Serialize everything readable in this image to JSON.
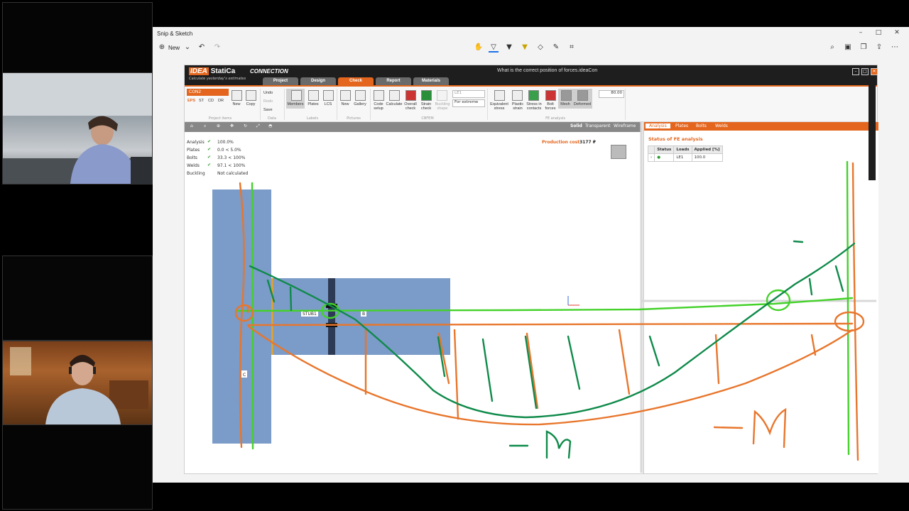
{
  "snip": {
    "title": "Snip & Sketch",
    "new_label": "New",
    "minimize": "–",
    "maximize": "□",
    "close": "✕"
  },
  "app": {
    "brand": "IDEA",
    "brand2": "StatiCa",
    "tagline": "Calculate yesterday's estimates",
    "product": "CONNECTION",
    "doc_title": "What is the correct position of forces.ideaCon",
    "tabs": [
      "Project",
      "Design",
      "Check",
      "Report",
      "Materials"
    ],
    "active_tab": "Check"
  },
  "ribbon": {
    "con_select": "CON2",
    "modes": [
      "EPS",
      "ST",
      "CD",
      "DR"
    ],
    "project_items": [
      "New",
      "Copy"
    ],
    "project_group": "Project items",
    "data_items": [
      "Undo",
      "Redo",
      "Save"
    ],
    "data_group": "Data",
    "labels_items": [
      "Members",
      "Plates",
      "LCS"
    ],
    "labels_group": "Labels",
    "pictures_items": [
      "New",
      "Gallery"
    ],
    "pictures_group": "Pictures",
    "cbfem_items": [
      "Code setup",
      "Calculate",
      "Overall check",
      "Strain check",
      "Buckling shape"
    ],
    "cbfem_group": "CBFEM",
    "load_select": "LE1",
    "extreme_select": "For extreme",
    "fe_items": [
      "Equivalent stress",
      "Plastic strain",
      "Stress in contacts",
      "Bolt forces",
      "Mesh",
      "Deformed"
    ],
    "fe_group": "FE analysis",
    "scale_value": "80.00"
  },
  "viewbar": {
    "modes": [
      "Solid",
      "Transparent",
      "Wireframe"
    ]
  },
  "status": [
    {
      "label": "Analysis",
      "value": "100.0%"
    },
    {
      "label": "Plates",
      "value": "0.0 < 5.0%"
    },
    {
      "label": "Bolts",
      "value": "33.3 < 100%"
    },
    {
      "label": "Welds",
      "value": "97.1 < 100%"
    },
    {
      "label": "Buckling",
      "value": "Not calculated"
    }
  ],
  "production_cost": {
    "label": "Production cost",
    "value": "3177 ₽"
  },
  "member_labels": {
    "stub": "STUB1",
    "b": "B",
    "c": "C"
  },
  "right_panel": {
    "tabs": [
      "Analysis",
      "Plates",
      "Bolts",
      "Welds"
    ],
    "subtitle": "Status of FE analysis",
    "headers": [
      "Status",
      "Loads",
      "Applied [%]"
    ],
    "row": {
      "loads": "LE1",
      "applied": "100.0"
    }
  },
  "annotation_text": "–M",
  "colors": {
    "accent": "#e4661e",
    "steel": "#7b9bc8",
    "green_pen": "#44d12a",
    "orange_pen": "#e8762c",
    "darkgreen_pen": "#0f8a4a"
  }
}
